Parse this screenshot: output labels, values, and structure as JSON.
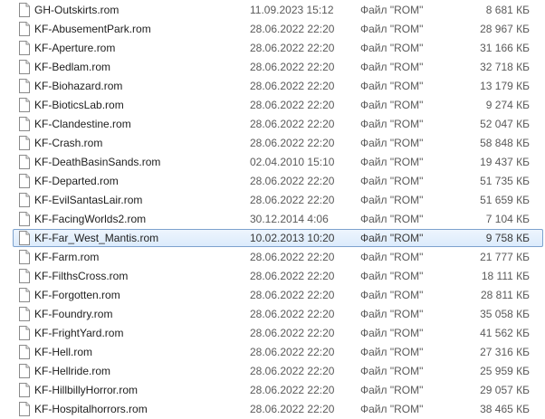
{
  "files": [
    {
      "name": "GH-Outskirts.rom",
      "date": "11.09.2023 15:12",
      "type": "Файл \"ROM\"",
      "size": "8 681 КБ"
    },
    {
      "name": "KF-AbusementPark.rom",
      "date": "28.06.2022 22:20",
      "type": "Файл \"ROM\"",
      "size": "28 967 КБ"
    },
    {
      "name": "KF-Aperture.rom",
      "date": "28.06.2022 22:20",
      "type": "Файл \"ROM\"",
      "size": "31 166 КБ"
    },
    {
      "name": "KF-Bedlam.rom",
      "date": "28.06.2022 22:20",
      "type": "Файл \"ROM\"",
      "size": "32 718 КБ"
    },
    {
      "name": "KF-Biohazard.rom",
      "date": "28.06.2022 22:20",
      "type": "Файл \"ROM\"",
      "size": "13 179 КБ"
    },
    {
      "name": "KF-BioticsLab.rom",
      "date": "28.06.2022 22:20",
      "type": "Файл \"ROM\"",
      "size": "9 274 КБ"
    },
    {
      "name": "KF-Clandestine.rom",
      "date": "28.06.2022 22:20",
      "type": "Файл \"ROM\"",
      "size": "52 047 КБ"
    },
    {
      "name": "KF-Crash.rom",
      "date": "28.06.2022 22:20",
      "type": "Файл \"ROM\"",
      "size": "58 848 КБ"
    },
    {
      "name": "KF-DeathBasinSands.rom",
      "date": "02.04.2010 15:10",
      "type": "Файл \"ROM\"",
      "size": "19 437 КБ"
    },
    {
      "name": "KF-Departed.rom",
      "date": "28.06.2022 22:20",
      "type": "Файл \"ROM\"",
      "size": "51 735 КБ"
    },
    {
      "name": "KF-EvilSantasLair.rom",
      "date": "28.06.2022 22:20",
      "type": "Файл \"ROM\"",
      "size": "51 659 КБ"
    },
    {
      "name": "KF-FacingWorlds2.rom",
      "date": "30.12.2014 4:06",
      "type": "Файл \"ROM\"",
      "size": "7 104 КБ"
    },
    {
      "name": "KF-Far_West_Mantis.rom",
      "date": "10.02.2013 10:20",
      "type": "Файл \"ROM\"",
      "size": "9 758 КБ",
      "selected": true
    },
    {
      "name": "KF-Farm.rom",
      "date": "28.06.2022 22:20",
      "type": "Файл \"ROM\"",
      "size": "21 777 КБ"
    },
    {
      "name": "KF-FilthsCross.rom",
      "date": "28.06.2022 22:20",
      "type": "Файл \"ROM\"",
      "size": "18 111 КБ"
    },
    {
      "name": "KF-Forgotten.rom",
      "date": "28.06.2022 22:20",
      "type": "Файл \"ROM\"",
      "size": "28 811 КБ"
    },
    {
      "name": "KF-Foundry.rom",
      "date": "28.06.2022 22:20",
      "type": "Файл \"ROM\"",
      "size": "35 058 КБ"
    },
    {
      "name": "KF-FrightYard.rom",
      "date": "28.06.2022 22:20",
      "type": "Файл \"ROM\"",
      "size": "41 562 КБ"
    },
    {
      "name": "KF-Hell.rom",
      "date": "28.06.2022 22:20",
      "type": "Файл \"ROM\"",
      "size": "27 316 КБ"
    },
    {
      "name": "KF-Hellride.rom",
      "date": "28.06.2022 22:20",
      "type": "Файл \"ROM\"",
      "size": "25 959 КБ"
    },
    {
      "name": "KF-HillbillyHorror.rom",
      "date": "28.06.2022 22:20",
      "type": "Файл \"ROM\"",
      "size": "29 057 КБ"
    },
    {
      "name": "KF-Hospitalhorrors.rom",
      "date": "28.06.2022 22:20",
      "type": "Файл \"ROM\"",
      "size": "38 465 КБ"
    }
  ],
  "icons": {
    "file": "blank-file-icon"
  },
  "colors": {
    "selection_border": "#7da2ce",
    "selection_fill": "#dcebfc"
  }
}
